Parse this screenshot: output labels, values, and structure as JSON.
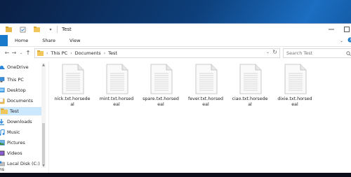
{
  "window": {
    "title": "Test"
  },
  "ribbon": {
    "file_tab": "",
    "tabs": [
      "Home",
      "Share",
      "View"
    ]
  },
  "address": {
    "crumbs": [
      "This PC",
      "Documents",
      "Test"
    ]
  },
  "search": {
    "placeholder": "Search Test"
  },
  "sidebar": {
    "items": [
      {
        "label": "OneDrive",
        "icon": "cloud-icon"
      },
      {
        "label": "This PC",
        "icon": "computer-icon"
      },
      {
        "label": "Desktop",
        "icon": "desktop-folder-icon"
      },
      {
        "label": "Documents",
        "icon": "documents-icon"
      },
      {
        "label": "Test",
        "icon": "folder-icon",
        "selected": true
      },
      {
        "label": "Downloads",
        "icon": "downloads-icon"
      },
      {
        "label": "Music",
        "icon": "music-icon"
      },
      {
        "label": "Pictures",
        "icon": "pictures-icon"
      },
      {
        "label": "Videos",
        "icon": "videos-icon"
      },
      {
        "label": "Local Disk (C:)",
        "icon": "drive-icon"
      }
    ]
  },
  "files": [
    {
      "name": "nick.txt.horsedeal"
    },
    {
      "name": "mint.txt.horsedeal"
    },
    {
      "name": "spare.txt.horsedeal"
    },
    {
      "name": "fever.txt.horsedeal"
    },
    {
      "name": "ciao.txt.horsedeal"
    },
    {
      "name": "dixie.txt.horsedeal"
    }
  ],
  "status": {
    "text": "ms"
  },
  "colors": {
    "accent": "#1979ca",
    "selection": "#cce8ff",
    "folder": "#e8b84a"
  }
}
